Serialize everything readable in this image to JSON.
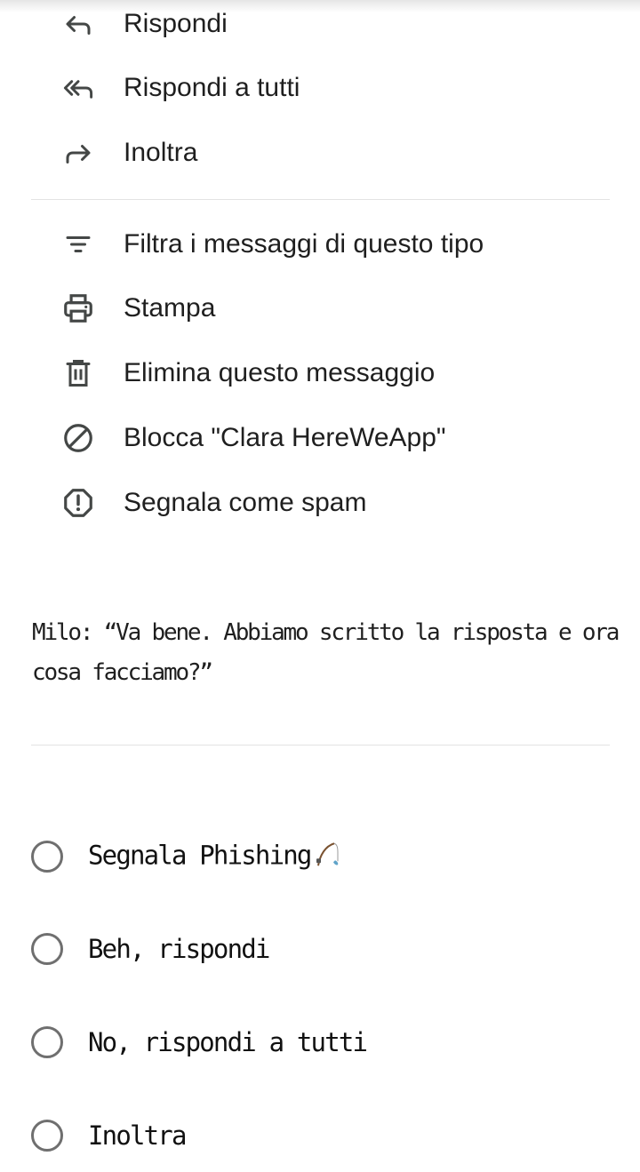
{
  "menu": {
    "items": [
      {
        "label": "Rispondi",
        "icon": "reply-icon"
      },
      {
        "label": "Rispondi a tutti",
        "icon": "reply-all-icon"
      },
      {
        "label": "Inoltra",
        "icon": "forward-icon"
      },
      {
        "label": "Filtra i messaggi di questo tipo",
        "icon": "filter-icon"
      },
      {
        "label": "Stampa",
        "icon": "print-icon"
      },
      {
        "label": "Elimina questo messaggio",
        "icon": "trash-icon"
      },
      {
        "label": "Blocca \"Clara HereWeApp\"",
        "icon": "block-icon"
      },
      {
        "label": "Segnala come spam",
        "icon": "report-spam-icon"
      }
    ]
  },
  "dialogue": {
    "text": "Milo: “Va bene. Abbiamo scritto la risposta e ora cosa facciamo?”"
  },
  "quiz": {
    "options": [
      {
        "label": "Segnala Phishing",
        "icon": "fishing-pole-icon"
      },
      {
        "label": "Beh, rispondi"
      },
      {
        "label": "No, rispondi a tutti"
      },
      {
        "label": "Inoltra"
      }
    ]
  },
  "colors": {
    "text": "#1f1f1f",
    "divider": "#e3e3e3",
    "radio_border": "#6f6f6f",
    "icon": "#444746"
  }
}
